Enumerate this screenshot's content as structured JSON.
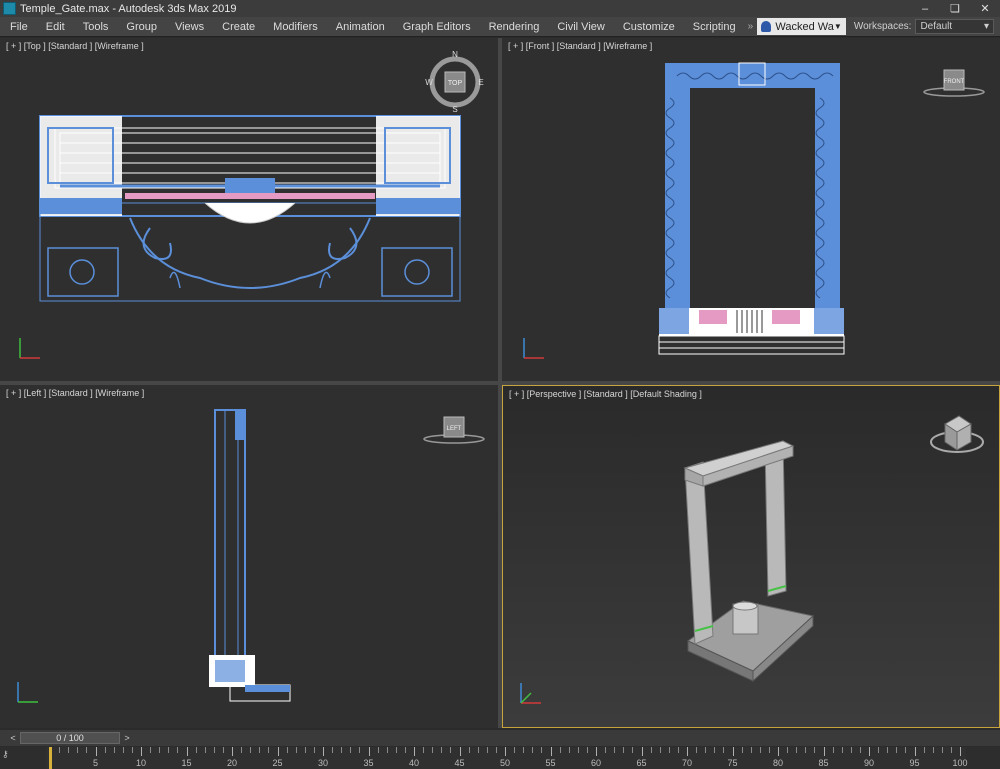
{
  "window": {
    "title": "Temple_Gate.max - Autodesk 3ds Max 2019",
    "buttons": [
      "–",
      "❏",
      "✕"
    ]
  },
  "menu": {
    "items": [
      "File",
      "Edit",
      "Tools",
      "Group",
      "Views",
      "Create",
      "Modifiers",
      "Animation",
      "Graph Editors",
      "Rendering",
      "Civil View",
      "Customize",
      "Scripting"
    ],
    "user_name": "Wacked Wa",
    "workspaces_label": "Workspaces:",
    "workspace_value": "Default"
  },
  "viewports": {
    "top": {
      "label": "[ + ] [Top ] [Standard ] [Wireframe ]",
      "cube_label": "TOP",
      "compass": [
        "N",
        "W",
        "E",
        "S"
      ]
    },
    "front": {
      "label": "[ + ] [Front ] [Standard ] [Wireframe ]",
      "cube_label": "FRONT"
    },
    "left": {
      "label": "[ + ] [Left ] [Standard ] [Wireframe ]",
      "cube_label": "LEFT"
    },
    "perspective": {
      "label": "[ + ] [Perspective ] [Standard ] [Default Shading ]"
    }
  },
  "timeline": {
    "frame_display": "0 / 100",
    "prev": "<",
    "next": ">",
    "ticks": [
      0,
      5,
      10,
      15,
      20,
      25,
      30,
      35,
      40,
      45,
      50,
      55,
      60,
      65,
      70,
      75,
      80,
      85,
      90,
      95,
      100
    ],
    "current_frame": 0
  },
  "colors": {
    "wire_blue": "#5b8fd9",
    "wire_white": "#ffffff",
    "wire_pink": "#e59ac4",
    "active_border": "#c8a43c"
  }
}
